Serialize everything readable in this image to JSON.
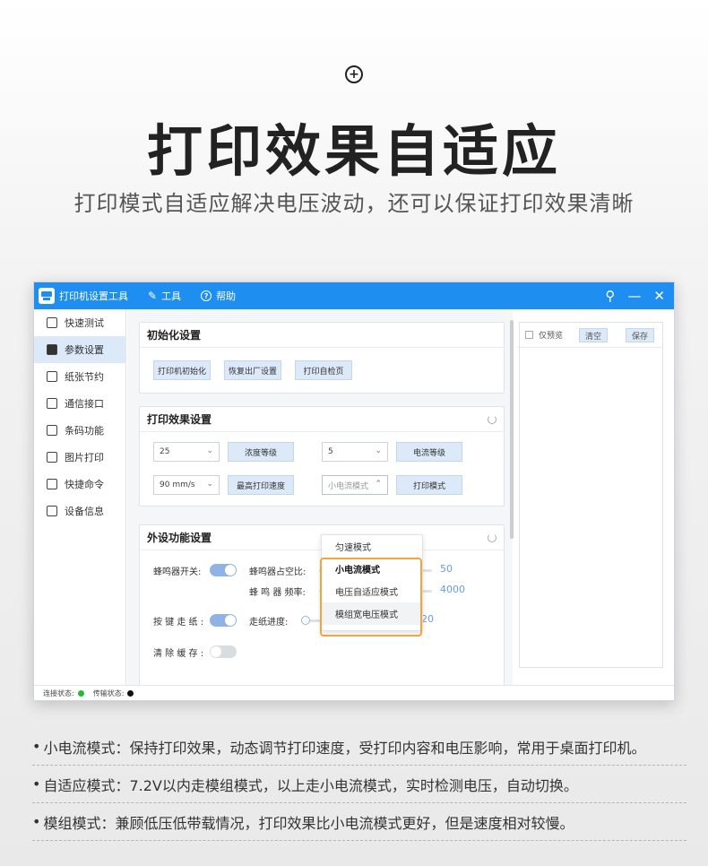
{
  "hero": {
    "title": "打印效果自适应",
    "subtitle": "打印模式自适应解决电压波动，还可以保证打印效果清晰"
  },
  "window": {
    "app_name": "打印机设置工具",
    "menu": [
      {
        "label": "工具",
        "icon": "tools-icon"
      },
      {
        "label": "帮助",
        "icon": "help-icon"
      }
    ],
    "controls": {
      "pin": "pin-icon",
      "minimize": "minimize-icon",
      "close": "close-icon"
    },
    "accent": "#1e8ff0"
  },
  "sidebar": {
    "items": [
      {
        "label": "快速测试",
        "icon": "quick-test-icon",
        "active": false
      },
      {
        "label": "参数设置",
        "icon": "parameters-icon",
        "active": true
      },
      {
        "label": "纸张节约",
        "icon": "paper-save-icon",
        "active": false
      },
      {
        "label": "通信接口",
        "icon": "interface-icon",
        "active": false
      },
      {
        "label": "条码功能",
        "icon": "barcode-icon",
        "active": false
      },
      {
        "label": "图片打印",
        "icon": "image-print-icon",
        "active": false
      },
      {
        "label": "快捷命令",
        "icon": "shortcut-icon",
        "active": false
      },
      {
        "label": "设备信息",
        "icon": "device-info-icon",
        "active": false
      }
    ]
  },
  "init_panel": {
    "title": "初始化设置",
    "buttons": [
      "打印机初始化",
      "恢复出厂设置",
      "打印自检页"
    ]
  },
  "effect_panel": {
    "title": "打印效果设置",
    "density_value": "25",
    "density_button": "浓度等级",
    "current_value": "5",
    "current_button": "电流等级",
    "speed_value": "90 mm/s",
    "speed_button": "最高打印速度",
    "mode_value": "小电流模式",
    "mode_button": "打印模式"
  },
  "mode_dropdown": {
    "options": [
      "匀速模式",
      "小电流模式",
      "电压自适应模式",
      "模组宽电压模式"
    ],
    "selected": "小电流模式",
    "highlight_color": "#f3a43c"
  },
  "external_panel": {
    "title": "外设功能设置",
    "buzzer_label": "蜂鸣器开关:",
    "buzzer_on": true,
    "duty_label": "蜂鸣器占空比:",
    "duty_value": "50",
    "freq_label": "蜂 鸣 器 频率:",
    "freq_value": "4000",
    "feed_label": "按 键 走 纸 :",
    "feed_on": true,
    "progress_label": "走纸进度:",
    "progress_value": "20",
    "clear_label": "清 除 缓 存 :",
    "clear_on": false
  },
  "preview": {
    "checkbox_label": "仅预览",
    "clear_button": "清空",
    "save_button": "保存"
  },
  "statusbar": {
    "connect_label": "连接状态:",
    "connect_color": "#22bb33",
    "transfer_label": "传输状态:",
    "transfer_color": "#111111"
  },
  "notes": [
    "小电流模式：保持打印效果，动态调节打印速度，受打印内容和电压影响，常用于桌面打印机。",
    "自适应模式：7.2V以内走模组模式，以上走小电流模式，实时检测电压，自动切换。",
    "模组模式：兼顾低压低带载情况，打印效果比小电流模式更好，但是速度相对较慢。"
  ]
}
